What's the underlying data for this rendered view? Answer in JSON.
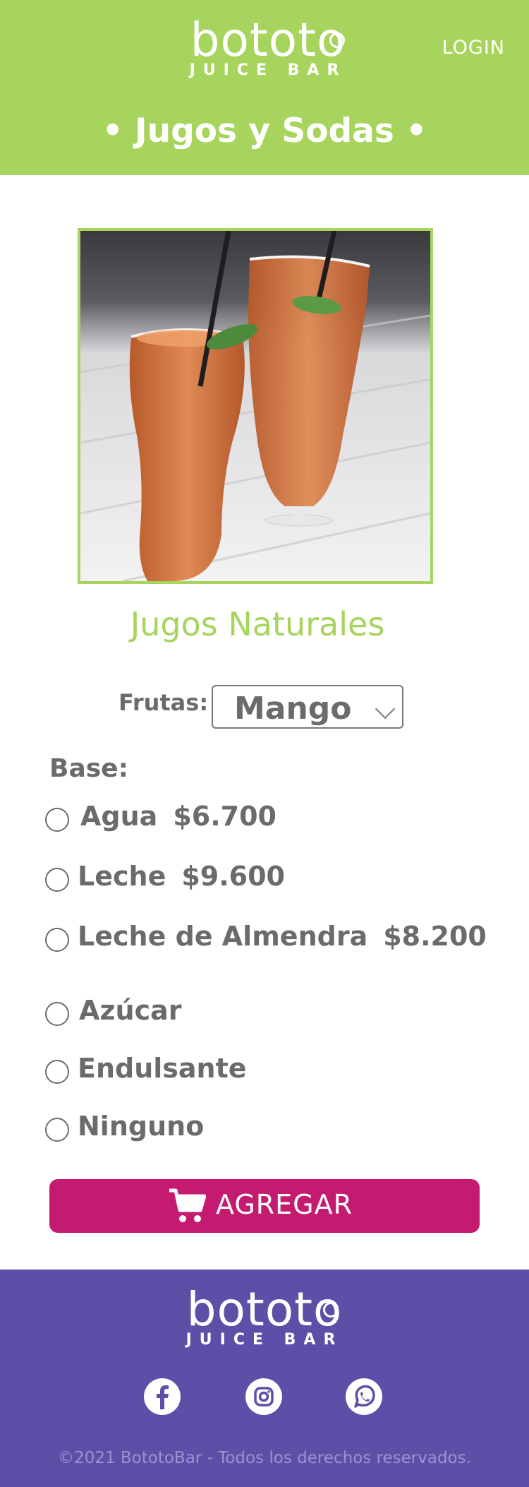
{
  "header": {
    "brand": "bototo",
    "brand_sub": "JUICE BAR",
    "login": "LOGIN",
    "category": "• Jugos y Sodas •"
  },
  "product": {
    "title": "Jugos Naturales",
    "fruit_label": "Frutas:",
    "fruit_selected": "Mango",
    "base_label": "Base:",
    "base_options": [
      {
        "name": "Agua",
        "price": "$6.700"
      },
      {
        "name": "Leche",
        "price": "$9.600"
      },
      {
        "name": "Leche de Almendra",
        "price": "$8.200"
      }
    ],
    "sweetener_options": [
      "Azúcar",
      "Endulsante",
      "Ninguno"
    ],
    "add_button": "AGREGAR"
  },
  "footer": {
    "brand": "bototo",
    "brand_sub": "JUICE BAR",
    "social_icons": [
      "facebook-icon",
      "instagram-icon",
      "whatsapp-icon"
    ],
    "copyright": "©2021 BototoBar - Todos los derechos reservados."
  },
  "colors": {
    "header_bg": "#a6d45c",
    "accent_green": "#a6d45c",
    "button_bg": "#c41a70",
    "footer_bg": "#5d4fa8"
  }
}
